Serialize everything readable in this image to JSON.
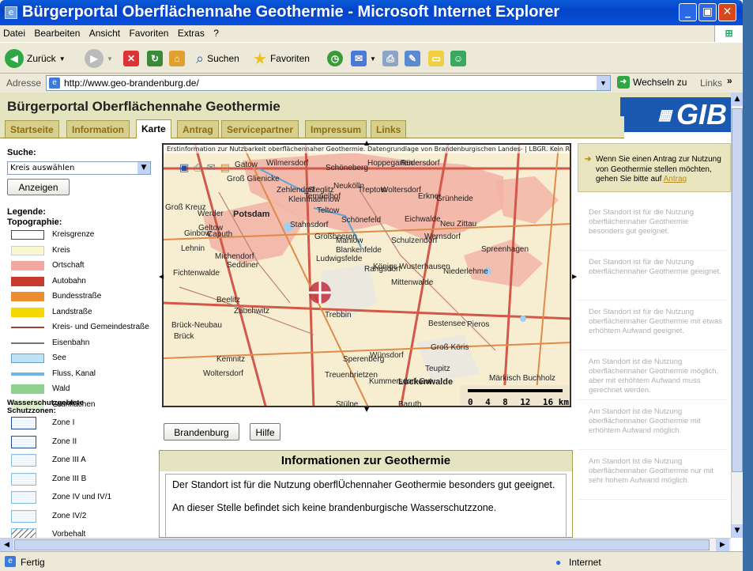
{
  "window": {
    "title": "Bürgerportal Oberflächennahe Geothermie - Microsoft Internet Explorer"
  },
  "menu": [
    "Datei",
    "Bearbeiten",
    "Ansicht",
    "Favoriten",
    "Extras",
    "?"
  ],
  "toolbar": {
    "back": "Zurück",
    "search": "Suchen",
    "favorites": "Favoriten"
  },
  "address": {
    "label": "Adresse",
    "url": "http://www.geo-brandenburg.de/",
    "go": "Wechseln zu",
    "links": "Links"
  },
  "page": {
    "title": "Bürgerportal Oberflächennahe Geothermie",
    "logo": "GIB",
    "tabs": [
      "Startseite",
      "Information",
      "Karte",
      "Antrag",
      "Servicepartner",
      "Impressum",
      "Links"
    ],
    "active_tab": "Karte"
  },
  "search": {
    "label": "Suche:",
    "select_value": "Kreis auswählen",
    "button": "Anzeigen"
  },
  "legend": {
    "title": "Legende:",
    "topo_title": "Topographie:",
    "topo": [
      {
        "label": "Kreisgrenze",
        "color": "#ffffff"
      },
      {
        "label": "Kreis",
        "color": "#fbf7cf"
      },
      {
        "label": "Ortschaft",
        "color": "#f0a8a0"
      },
      {
        "label": "Autobahn",
        "color": "#c8382c"
      },
      {
        "label": "Bundesstraße",
        "color": "#f08c30"
      },
      {
        "label": "Landstraße",
        "color": "#f5d800"
      },
      {
        "label": "Kreis- und Gemeindestraße",
        "color": "#a04040"
      },
      {
        "label": "Eisenbahn",
        "color": "#777777"
      },
      {
        "label": "See",
        "color": "#bfe3f6"
      },
      {
        "label": "Fluss, Kanal",
        "color": "#6fb6e8"
      },
      {
        "label": "Wald",
        "color": "#8fcf8f"
      },
      {
        "label": "Grünflächen",
        "color": "#dff0d0"
      }
    ],
    "water_title": "Wasserschutzgebiete Schutzzonen:",
    "zones": [
      "Zone I",
      "Zone II",
      "Zone III A",
      "Zone III B",
      "Zone IV und IV/1",
      "Zone IV/2",
      "Vorbehalt"
    ]
  },
  "map": {
    "note": "Erstinformation zur Nutzbarkeit oberflächennaher Geothermie. Datengrundlage von Brandenburgischen Landes- | LBGR. Kein Rechtsanspruch aus diesen Informationen! Haftungsausschluss!",
    "towns": [
      "Gatow",
      "Wilmersdorf",
      "Schöneberg",
      "Hoppegarten",
      "Rüdersdorf",
      "Groß Glienicke",
      "Zehlendorf",
      "Steglitz",
      "Tempelhof",
      "Neukölln",
      "Treptow",
      "Woltersdorf",
      "Erkner",
      "Grünheide",
      "Groß Kreuz",
      "Werder",
      "Potsdam",
      "Kleinmachnow",
      "Teltow",
      "Stahnsdorf",
      "Schönefeld",
      "Eichwalde",
      "Neu Zittau",
      "Geltow",
      "Ginbow",
      "Caputh",
      "Michendorf",
      "Seddiner",
      "Großbeeren",
      "Mahlow",
      "Blankenfelde",
      "Schulzendorf",
      "Wernsdorf",
      "Lehnin",
      "Ludwigsfelde",
      "Rangsdorf",
      "Königs Wusterhausen",
      "Niederlehme",
      "Spreenhagen",
      "Fichtenwalde",
      "Beelitz",
      "Zauchwitz",
      "Trebbin",
      "Mittenwalde",
      "Brück-Neubau",
      "Brück",
      "Bestensee",
      "Pieros",
      "Wünsdorf",
      "Groß Köris",
      "Kemnitz",
      "Sperenberg",
      "Teupitz",
      "Märkisch Buchholz",
      "Woltersdorf",
      "Treuenbrietzen",
      "Luckenwalde",
      "Kummersdorf-Gut",
      "Stülpe",
      "Baruth"
    ],
    "scale_labels": [
      "0",
      "4",
      "8",
      "12",
      "16 km"
    ]
  },
  "map_buttons": {
    "left": "Brandenburg",
    "help": "Hilfe"
  },
  "info": {
    "title": "Informationen zur Geothermie",
    "line1": "Der Standort ist für die Nutzung oberflÜchennaher Geothermie besonders gut geeignet.",
    "line2": "An dieser Stelle befindet sich keine brandenburgische Wasserschutzzone."
  },
  "right": {
    "notice_pre": "Wenn Sie einen Antrag zur Nutzung von Geothermie stellen möchten, gehen Sie bitte auf ",
    "notice_link": "Antrag",
    "items": [
      "Der Standort ist für die Nutzung oberflächennaher Geothermie besonders gut geeignet.",
      "Der Standort ist für die Nutzung oberflächennaher Geothermie geeignet.",
      "Der Standort ist für die Nutzung oberflächennaher Geothermie mit etwas erhöhtem Aufwand geeignet.",
      "Am Standort ist die Nutzung oberflächennaher Geothermie möglich, aber mit erhöhtem Aufwand muss gerechnet werden.",
      "Am Standort ist die Nutzung oberflächennaher Geothermie mit erhöhtem Aufwand möglich.",
      "Am Standort ist die Nutzung oberflächennaher Geothermie nur mit sehr hohem Aufwand möglich."
    ]
  },
  "status": {
    "left": "Fertig",
    "zone": "Internet"
  }
}
